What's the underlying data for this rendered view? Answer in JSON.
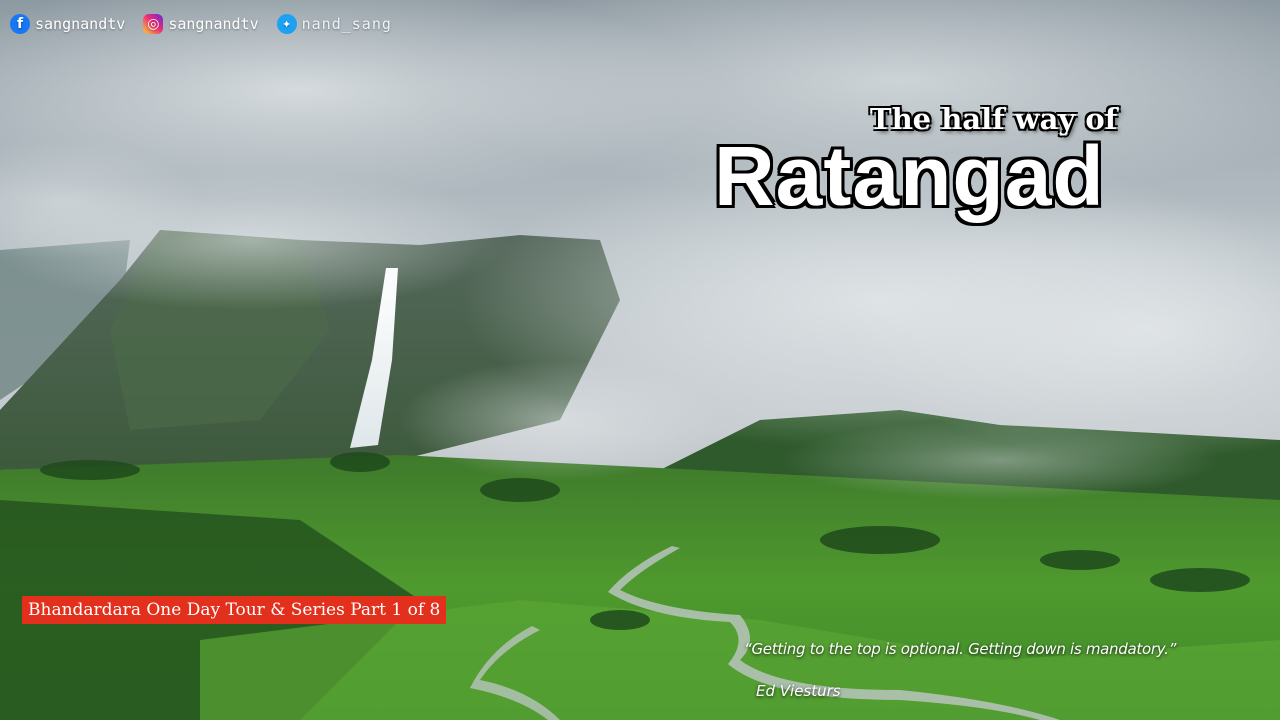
{
  "social": {
    "facebook": {
      "icon": "facebook-icon",
      "handle": "sangnandtv"
    },
    "instagram": {
      "icon": "instagram-icon",
      "handle": "sangnandtv"
    },
    "twitter": {
      "icon": "twitter-icon",
      "handle": "nand_sang"
    }
  },
  "title": {
    "subtitle": "The half way of",
    "main": "Ratangad"
  },
  "series": {
    "label": "Bhandardara One Day Tour & Series Part 1 of 8",
    "color": "#e2301c"
  },
  "quote": {
    "text": "“Getting to the top is optional. Getting down is mandatory.”",
    "author": "Ed Viesturs"
  }
}
